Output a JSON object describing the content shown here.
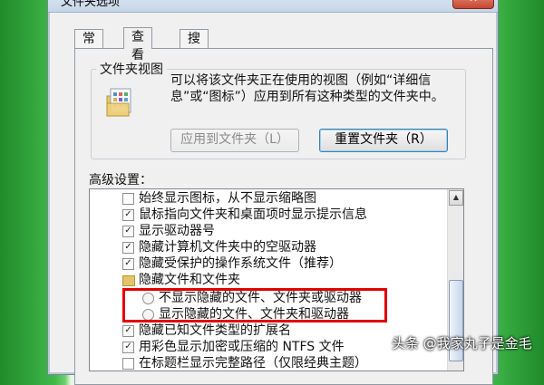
{
  "window": {
    "title": "文件夹选项",
    "close_label": "✕"
  },
  "tabs": [
    {
      "label": "常规",
      "active": false
    },
    {
      "label": "查看",
      "active": true
    },
    {
      "label": "搜索",
      "active": false
    }
  ],
  "folder_views": {
    "group_label": "文件夹视图",
    "description": "可以将该文件夹正在使用的视图（例如“详细信息”或“图标”）应用到所有这种类型的文件夹中。",
    "apply_button": "应用到文件夹（L）",
    "reset_button": "重置文件夹（R）"
  },
  "advanced": {
    "label": "高级设置：",
    "items": [
      {
        "kind": "checkbox",
        "checked": false,
        "label": "始终显示图标，从不显示缩略图"
      },
      {
        "kind": "checkbox",
        "checked": true,
        "label": "鼠标指向文件夹和桌面项时显示提示信息"
      },
      {
        "kind": "checkbox",
        "checked": true,
        "label": "显示驱动器号"
      },
      {
        "kind": "checkbox",
        "checked": true,
        "label": "隐藏计算机文件夹中的空驱动器"
      },
      {
        "kind": "checkbox",
        "checked": true,
        "label": "隐藏受保护的操作系统文件（推荐）"
      },
      {
        "kind": "folder",
        "label": "隐藏文件和文件夹"
      },
      {
        "kind": "radio",
        "checked": false,
        "label": "不显示隐藏的文件、文件夹或驱动器"
      },
      {
        "kind": "radio",
        "checked": false,
        "label": "显示隐藏的文件、文件夹和驱动器"
      },
      {
        "kind": "checkbox",
        "checked": true,
        "label": "隐藏已知文件类型的扩展名"
      },
      {
        "kind": "checkbox",
        "checked": true,
        "label": "用彩色显示加密或压缩的 NTFS 文件"
      },
      {
        "kind": "checkbox",
        "checked": false,
        "label": "在标题栏显示完整路径（仅限经典主题）"
      }
    ]
  },
  "watermark": "头条 @我家丸子是金毛"
}
